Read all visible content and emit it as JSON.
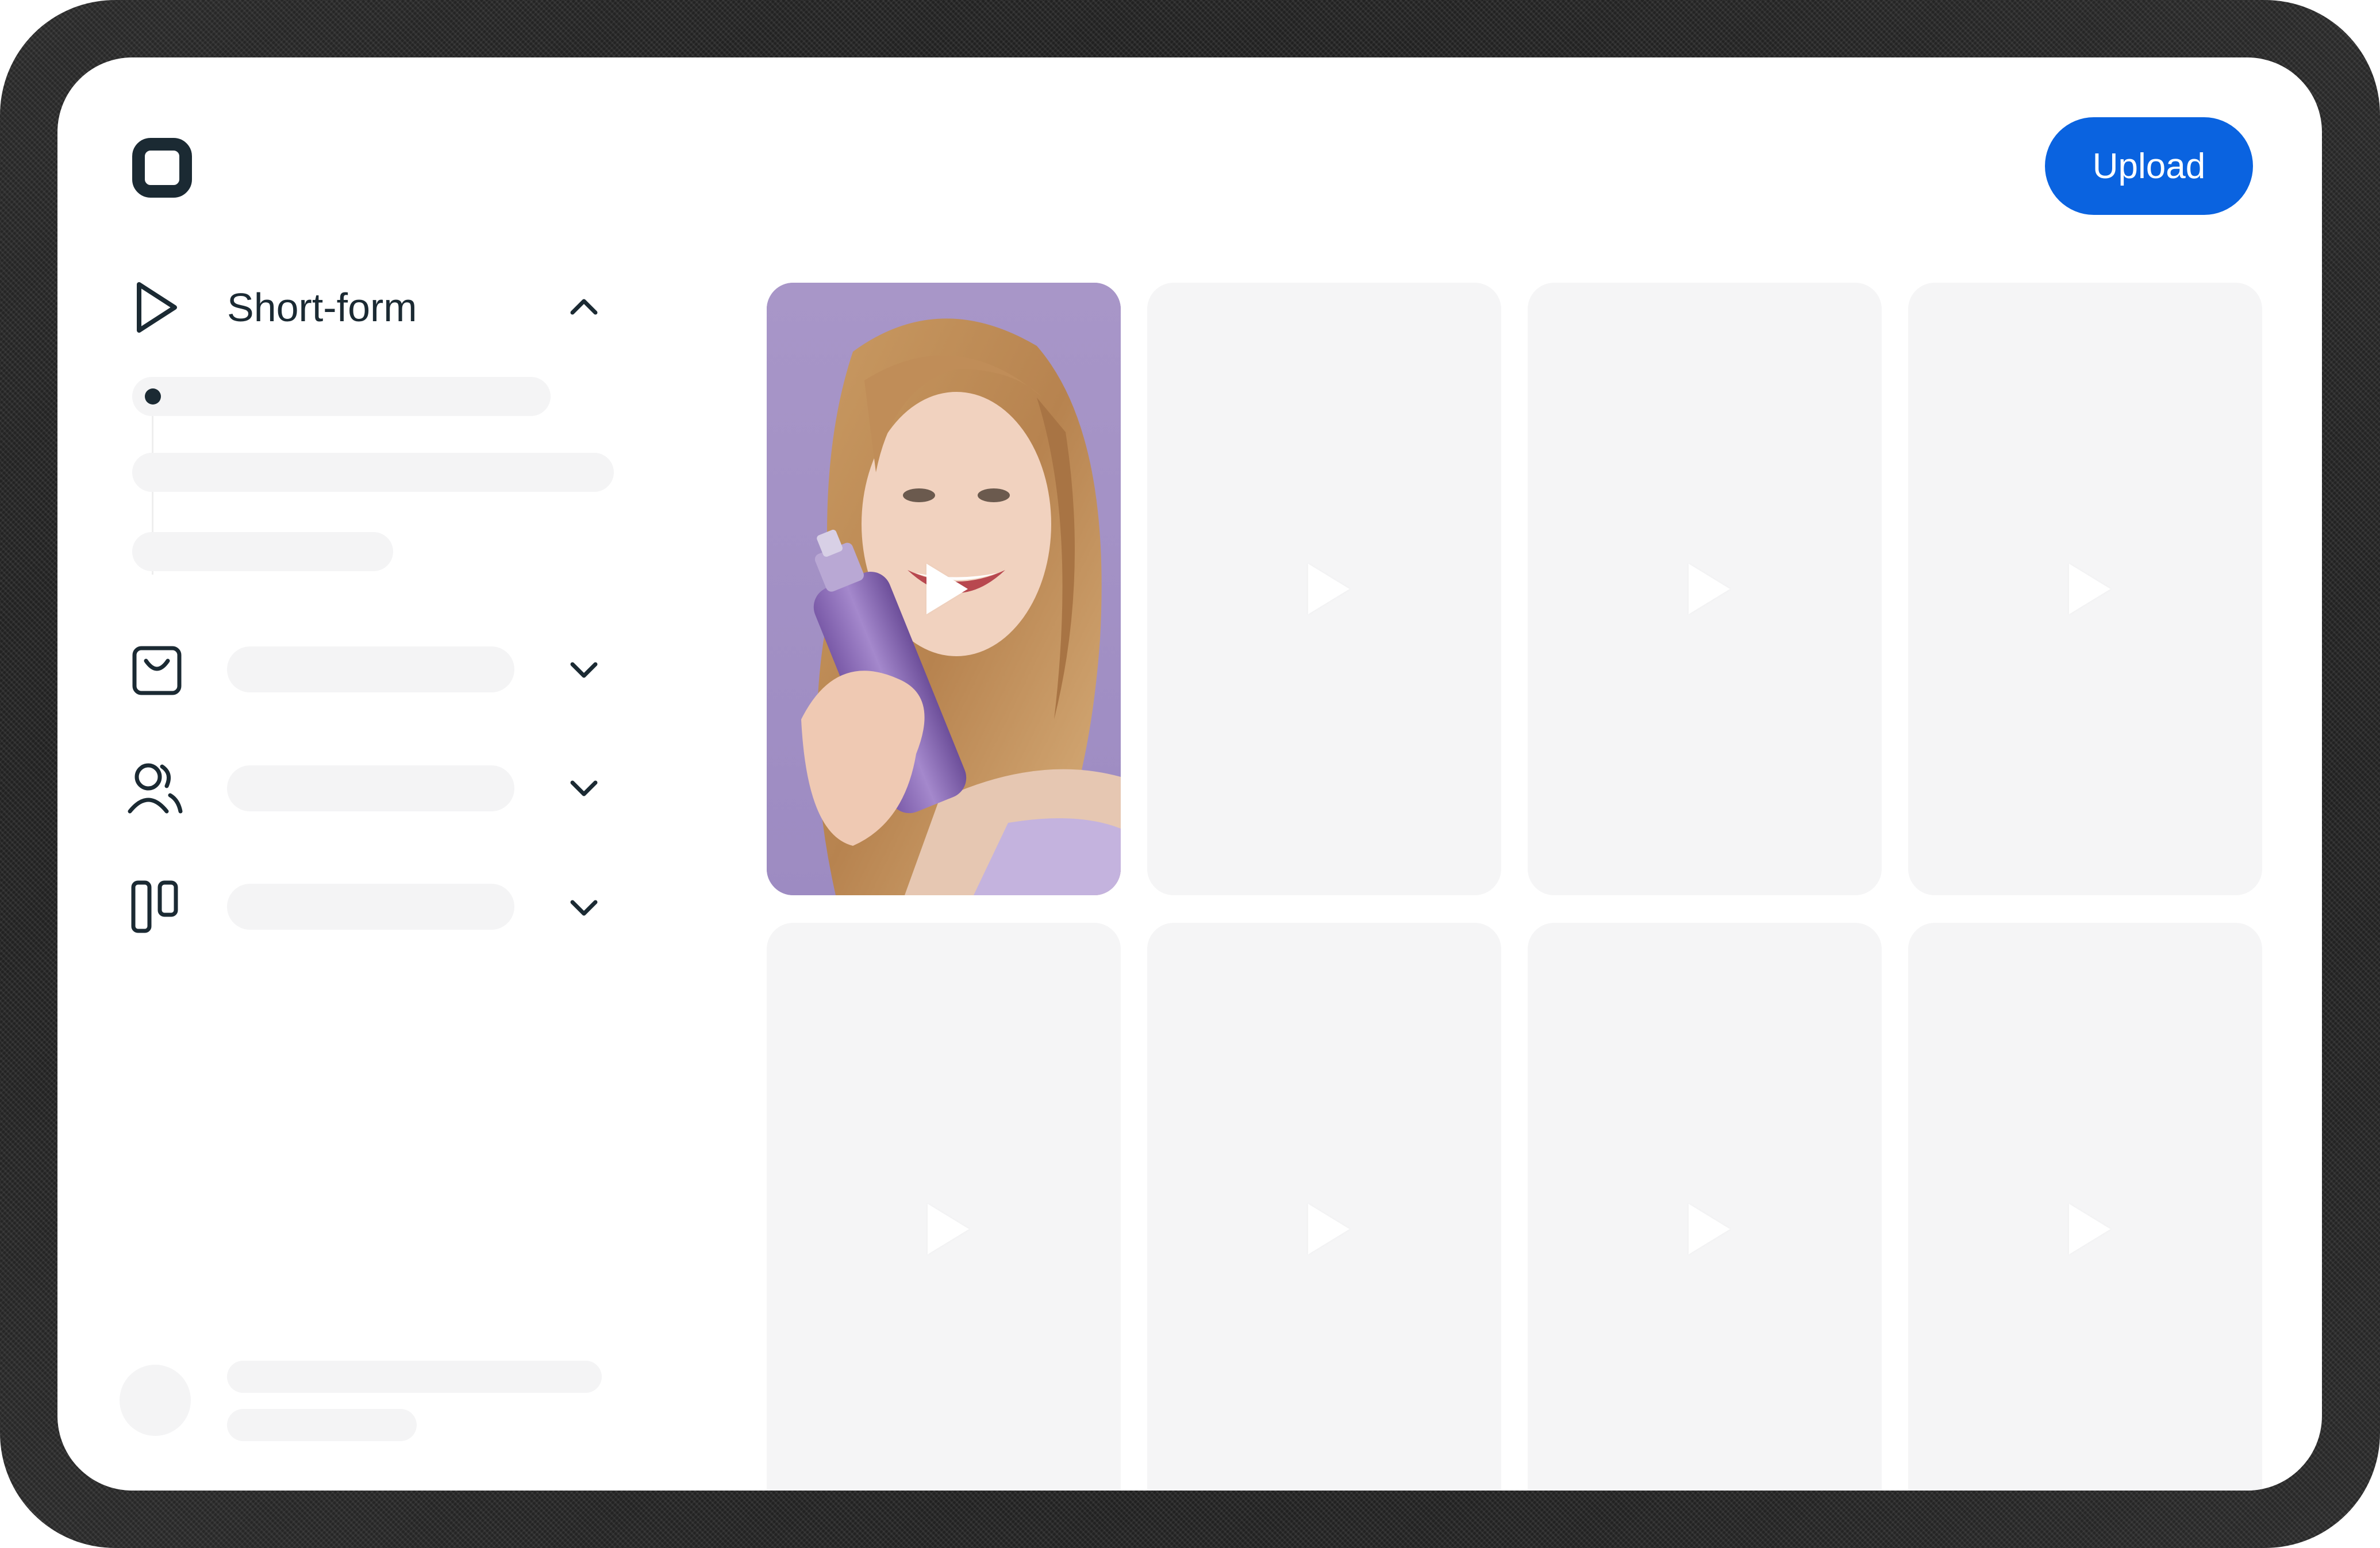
{
  "header": {
    "upload_label": "Upload"
  },
  "colors": {
    "accent": "#0a63e0",
    "ink": "#1b2a33",
    "placeholder": "#f4f4f5",
    "card": "#f5f5f6"
  },
  "sidebar": {
    "sections": [
      {
        "label": "Short-form",
        "icon": "play-icon",
        "expanded": true
      },
      {
        "label": "",
        "icon": "shopping-bag-icon",
        "expanded": false
      },
      {
        "label": "",
        "icon": "users-icon",
        "expanded": false
      },
      {
        "label": "",
        "icon": "columns-icon",
        "expanded": false
      }
    ]
  },
  "grid": {
    "cards": [
      {
        "kind": "featured",
        "icon": "play-icon"
      },
      {
        "kind": "placeholder",
        "icon": "play-icon"
      },
      {
        "kind": "placeholder",
        "icon": "play-icon"
      },
      {
        "kind": "placeholder",
        "icon": "play-icon"
      },
      {
        "kind": "placeholder",
        "icon": "play-icon"
      },
      {
        "kind": "placeholder",
        "icon": "play-icon"
      },
      {
        "kind": "placeholder",
        "icon": "play-icon"
      },
      {
        "kind": "placeholder",
        "icon": "play-icon"
      }
    ]
  }
}
